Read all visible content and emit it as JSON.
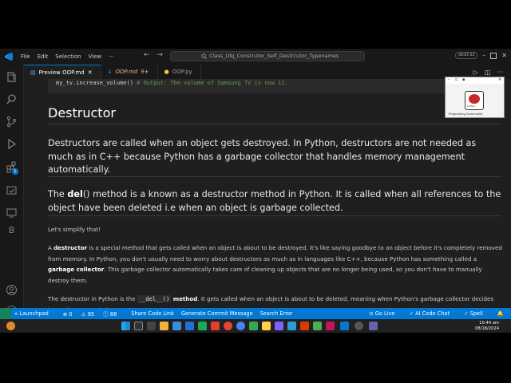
{
  "menu": [
    "File",
    "Edit",
    "Selection",
    "View"
  ],
  "search": {
    "text": "Class_Obj_Construtor_Self_Destrcutor_Typenames"
  },
  "titlebar": {
    "pill": "00:07:23"
  },
  "tabs": [
    {
      "label": "Preview OOP.md",
      "modified": ""
    },
    {
      "label": "OOP.md",
      "modified": "9+"
    },
    {
      "label": "OOP.py",
      "modified": ""
    }
  ],
  "activity": {
    "extensions_badge": "1"
  },
  "code": {
    "line": "my_tv.increase_volume()  ",
    "comment": "# Output: The volume of Samsung TV is now 11."
  },
  "content": {
    "heading": "Destructor",
    "para1": "Destructors are called when an object gets destroyed. In Python, destructors are not needed as much as in C++ because Python has a garbage collector that handles memory management automatically.",
    "para2_pre": "The ",
    "para2_bold": "del",
    "para2_post": "() method is a known as a destructor method in Python. It is called when all references to the object have been deleted i.e when an object is garbage collected.",
    "simplify": "Let's simplify that!",
    "p3_a": "A ",
    "p3_b": "destructor",
    "p3_c": " is a special method that gets called when an object is about to be destroyed. It's like saying goodbye to an object before it's completely removed from memory. In Python, you don't usually need to worry about destructors as much as in languages like C++, because Python has something called a ",
    "p3_d": "garbage collector",
    "p3_e": ". This garbage collector automatically takes care of cleaning up objects that are no longer being used, so you don't have to manually destroy them.",
    "p4_a": "The destructor in Python is the ",
    "p4_code": "__del__()",
    "p4_b": " method",
    "p4_c": ". It gets called when an object is about to be deleted, meaning when Python's garbage collector decides it's no longer needed."
  },
  "pip": {
    "caption": "Programing Community",
    "logo_text": "Python"
  },
  "status": {
    "launchpad": "Launchpad",
    "errors": "0",
    "warnings": "95",
    "infos": "88",
    "share": "Share Code Link",
    "commit": "Generate Commit Message",
    "search_error": "Search Error",
    "golive": "Go Live",
    "aichat": "AI Code Chat",
    "spell": "Spell"
  },
  "clock": {
    "time": "10:44 am",
    "date": "08/18/2024"
  }
}
